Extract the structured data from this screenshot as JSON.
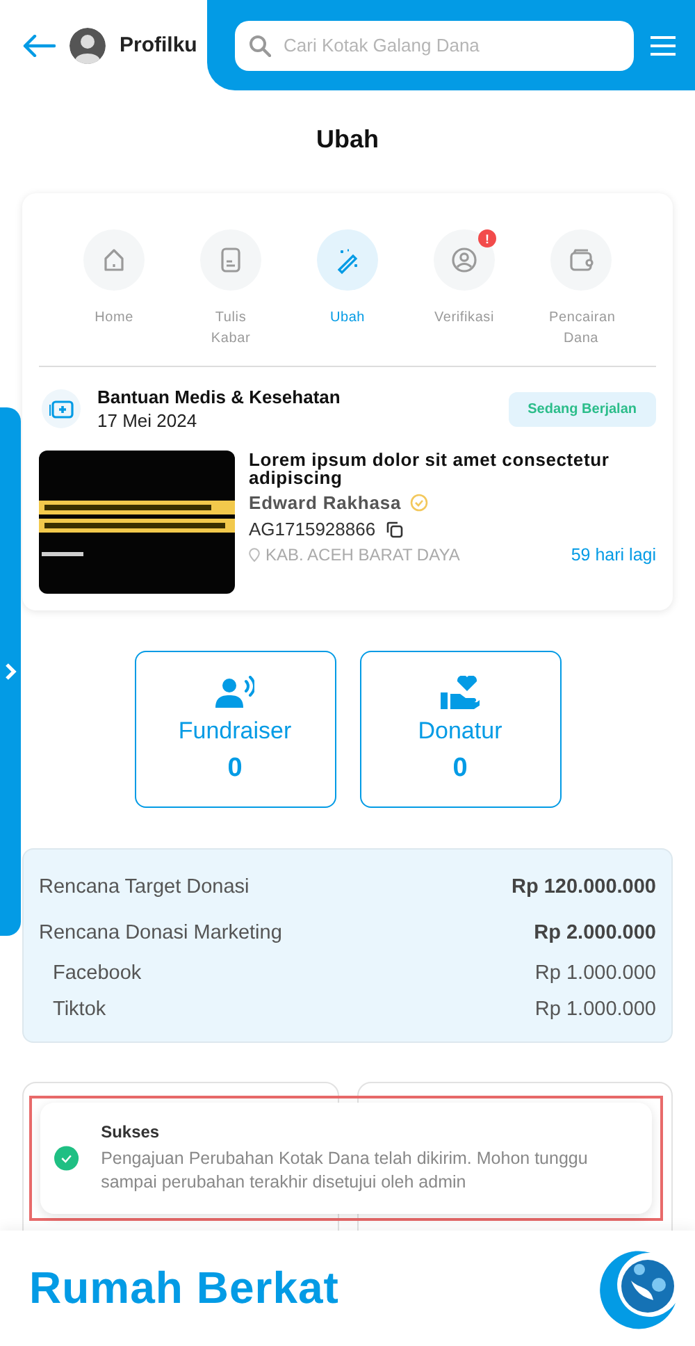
{
  "header": {
    "profile_name": "Profilku",
    "search": {
      "placeholder": "Cari Kotak Galang Dana"
    }
  },
  "title": "Ubah",
  "tabs": [
    {
      "kind": "home",
      "label": "Home",
      "selected": false
    },
    {
      "kind": "write",
      "label": "Tulis Kabar",
      "selected": false
    },
    {
      "kind": "edit",
      "label": "Ubah",
      "selected": true
    },
    {
      "kind": "verify",
      "label": "Verifikasi",
      "selected": false,
      "badge": "!"
    },
    {
      "kind": "withdraw",
      "label": "Pencairan Dana",
      "selected": false
    }
  ],
  "campaign": {
    "category": "Bantuan Medis & Kesehatan",
    "date": "17 Mei 2024",
    "status": "Sedang Berjalan",
    "title": "Lorem ipsum dolor sit amet consectetur adipiscing",
    "author": "Edward Rakhasa",
    "verified": true,
    "code": "AG1715928866",
    "location": "KAB. ACEH BARAT DAYA",
    "days_left": "59 hari lagi"
  },
  "stats": [
    {
      "kind": "fundraiser",
      "label": "Fundraiser",
      "value": "0"
    },
    {
      "kind": "donor",
      "label": "Donatur",
      "value": "0"
    }
  ],
  "summary": [
    {
      "kind": "main",
      "label": "Rencana Target Donasi",
      "value": "Rp 120.000.000"
    },
    {
      "kind": "main",
      "label": "Rencana Donasi Marketing",
      "value": "Rp 2.000.000"
    },
    {
      "kind": "sub",
      "label": "Facebook",
      "value": "Rp 1.000.000"
    },
    {
      "kind": "sub",
      "label": "Tiktok",
      "value": "Rp 1.000.000"
    }
  ],
  "toast": {
    "title": "Sukses",
    "message": "Pengajuan Perubahan Kotak Dana telah dikirim. Mohon tunggu sampai perubahan terakhir disetujui oleh admin"
  },
  "footer": {
    "brand": "Rumah Berkat"
  }
}
